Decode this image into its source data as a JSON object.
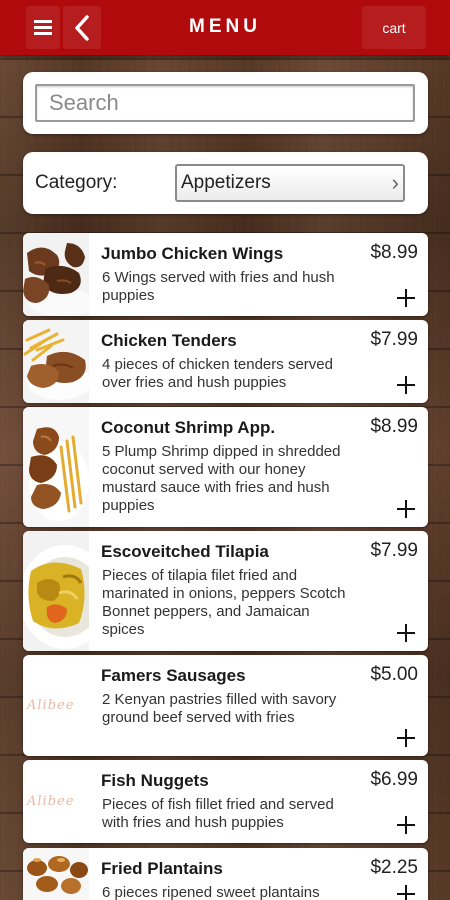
{
  "header": {
    "title": "MENU",
    "cart_label": "cart",
    "menu_icon": "hamburger-icon",
    "back_icon": "back-arrow-icon"
  },
  "search": {
    "placeholder": "Search"
  },
  "category": {
    "label": "Category:",
    "selected": "Appetizers",
    "chevron": "›"
  },
  "colors": {
    "header": "#b00a0d",
    "card": "#ffffff"
  },
  "items": [
    {
      "name": "Jumbo Chicken Wings",
      "price": "$8.99",
      "description": "6 Wings served with fries and hush puppies",
      "image": "chicken-wings-photo"
    },
    {
      "name": "Chicken Tenders",
      "price": "$7.99",
      "description": "4 pieces of chicken tenders served over fries and hush puppies",
      "image": "chicken-tenders-photo"
    },
    {
      "name": "Coconut Shrimp App.",
      "price": "$8.99",
      "description": "5 Plump Shrimp dipped in shredded coconut served with our honey mustard sauce with fries and hush puppies",
      "image": "coconut-shrimp-photo"
    },
    {
      "name": "Escoveitched Tilapia",
      "price": "$7.99",
      "description": "Pieces of tilapia filet fried and marinated in onions, peppers Scotch Bonnet peppers, and Jamaican spices",
      "image": "tilapia-photo"
    },
    {
      "name": "Famers Sausages",
      "price": "$5.00",
      "description": "2 Kenyan pastries filled with savory ground beef served with fries",
      "image": "restaurant-logo-placeholder",
      "logo_text": "Alibee"
    },
    {
      "name": "Fish Nuggets",
      "price": "$6.99",
      "description": "Pieces of fish fillet fried and served with fries and hush puppies",
      "image": "restaurant-logo-placeholder",
      "logo_text": "Alibee"
    },
    {
      "name": "Fried Plantains",
      "price": "$2.25",
      "description": "6 pieces ripened sweet plantains",
      "image": "fried-plantains-photo"
    }
  ]
}
